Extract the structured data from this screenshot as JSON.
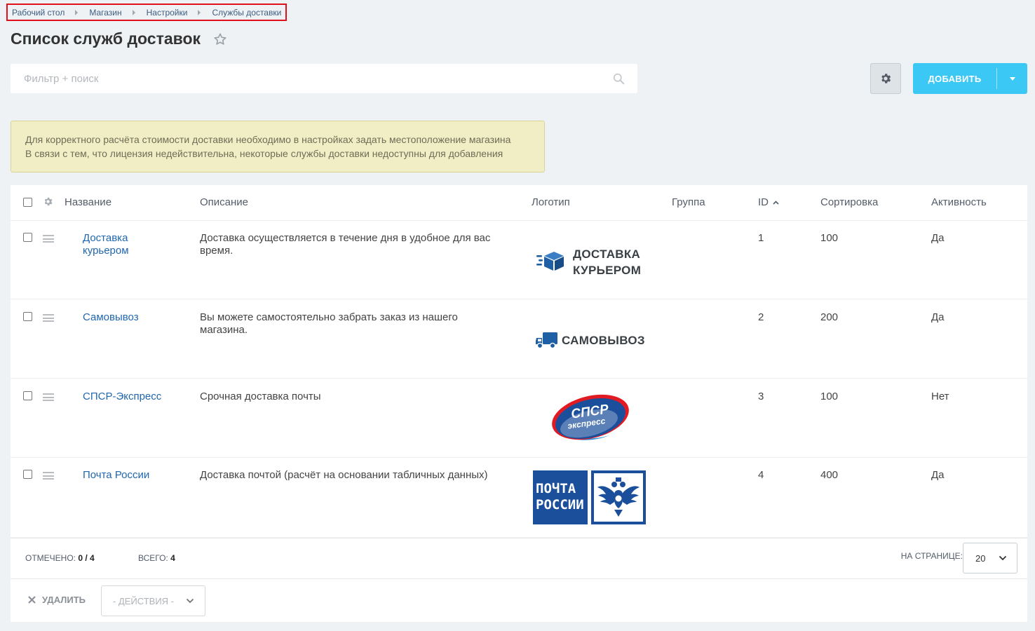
{
  "breadcrumb": [
    "Рабочий стол",
    "Магазин",
    "Настройки",
    "Службы доставки"
  ],
  "page_title": "Список служб доставок",
  "search": {
    "placeholder": "Фильтр + поиск"
  },
  "toolbar": {
    "add_label": "ДОБАВИТЬ"
  },
  "alert": {
    "lines": [
      "Для корректного расчёта стоимости доставки необходимо в настройках задать местоположение магазина",
      "В связи с тем, что лицензия недействительна, некоторые службы доставки недоступны для добавления"
    ]
  },
  "table": {
    "columns": [
      "Название",
      "Описание",
      "Логотип",
      "Группа",
      "ID",
      "Сортировка",
      "Активность"
    ],
    "rows": [
      {
        "name": "Доставка курьером",
        "description": "Доставка осуществляется в течение дня в удобное для вас время.",
        "logo_text": [
          "ДОСТАВКА",
          "КУРЬЕРОМ"
        ],
        "group": "",
        "id": "1",
        "sort": "100",
        "active": "Да"
      },
      {
        "name": "Самовывоз",
        "description": "Вы можете самостоятельно забрать заказ из нашего магазина.",
        "logo_text": [
          "САМОВЫВОЗ"
        ],
        "group": "",
        "id": "2",
        "sort": "200",
        "active": "Да"
      },
      {
        "name": "СПСР-Экспресс",
        "description": "Срочная доставка почты",
        "logo_text": [
          "СПСР",
          "экспресс"
        ],
        "group": "",
        "id": "3",
        "sort": "100",
        "active": "Нет"
      },
      {
        "name": "Почта России",
        "description": "Доставка почтой (расчёт на основании табличных данных)",
        "logo_text": [
          "ПОЧТА",
          "РОССИИ"
        ],
        "group": "",
        "id": "4",
        "sort": "400",
        "active": "Да"
      }
    ]
  },
  "footer": {
    "checked_label": "ОТМЕЧЕНО:",
    "checked_value": "0 / 4",
    "total_label": "ВСЕГО:",
    "total_value": "4",
    "per_page_label": "НА СТРАНИЦЕ:",
    "per_page_value": "20"
  },
  "actions": {
    "delete_label": "УДАЛИТЬ",
    "select_label": "- ДЕЙСТВИЯ -"
  },
  "colors": {
    "accent": "#3bc8f5",
    "link": "#2067b0",
    "alert_bg": "#f1edc4",
    "highlight_border": "#e0111b",
    "logo_dark": "#3a3f44",
    "logo_blue": "#1f5fa6",
    "spsr_red": "#e21b23",
    "pochta_blue": "#1b4f9b"
  }
}
